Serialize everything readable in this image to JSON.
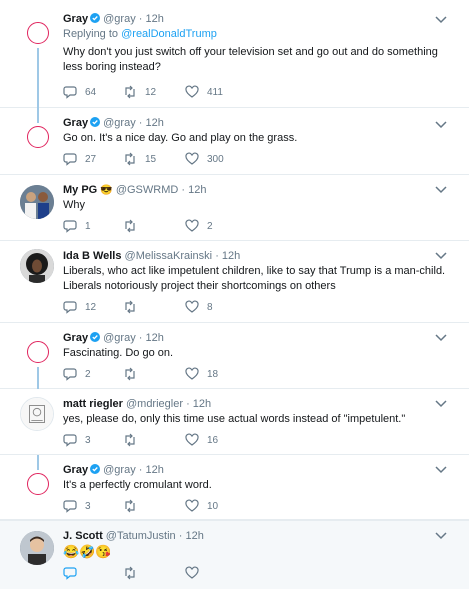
{
  "colors": {
    "accent": "#1da1f2",
    "like": "#e0245e",
    "thread_line": "#9fc8e6",
    "muted": "#657786"
  },
  "tweets": [
    {
      "name": "Gray",
      "verified": true,
      "handle": "@gray",
      "time": "12h",
      "reply_prefix": "Replying to",
      "reply_to": "@realDonaldTrump",
      "text": "Why don't you just switch off your television set and go out and do something less boring instead?",
      "replies": "64",
      "retweets": "12",
      "likes": "411"
    },
    {
      "name": "Gray",
      "verified": true,
      "handle": "@gray",
      "time": "12h",
      "text": "Go on. It's a nice day. Go and play on the grass.",
      "replies": "27",
      "retweets": "15",
      "likes": "300"
    },
    {
      "name": "My PG",
      "name_emoji": "😎",
      "verified": false,
      "handle": "@GSWRMD",
      "time": "12h",
      "text": "Why",
      "replies": "1",
      "retweets": "",
      "likes": "2"
    },
    {
      "name": "Ida B Wells",
      "verified": false,
      "handle": "@MelissaKrainski",
      "time": "12h",
      "text": "Liberals, who act like impetulent children, like to say that Trump is a man-child. Liberals notoriously project their shortcomings on others",
      "replies": "12",
      "retweets": "",
      "likes": "8"
    },
    {
      "name": "Gray",
      "verified": true,
      "handle": "@gray",
      "time": "12h",
      "text": "Fascinating. Do go on.",
      "replies": "2",
      "retweets": "",
      "likes": "18"
    },
    {
      "name": "matt riegler",
      "verified": false,
      "handle": "@mdriegler",
      "time": "12h",
      "text": "yes, please do, only this time use actual words instead of \"impetulent.\"",
      "replies": "3",
      "retweets": "",
      "likes": "16"
    },
    {
      "name": "Gray",
      "verified": true,
      "handle": "@gray",
      "time": "12h",
      "text": "It's a perfectly cromulant word.",
      "replies": "3",
      "retweets": "",
      "likes": "10"
    },
    {
      "name": "J. Scott",
      "verified": false,
      "handle": "@TatumJustin",
      "time": "12h",
      "text": "😂🤣😘",
      "replies": "",
      "retweets": "",
      "likes": ""
    }
  ],
  "separator": "·"
}
